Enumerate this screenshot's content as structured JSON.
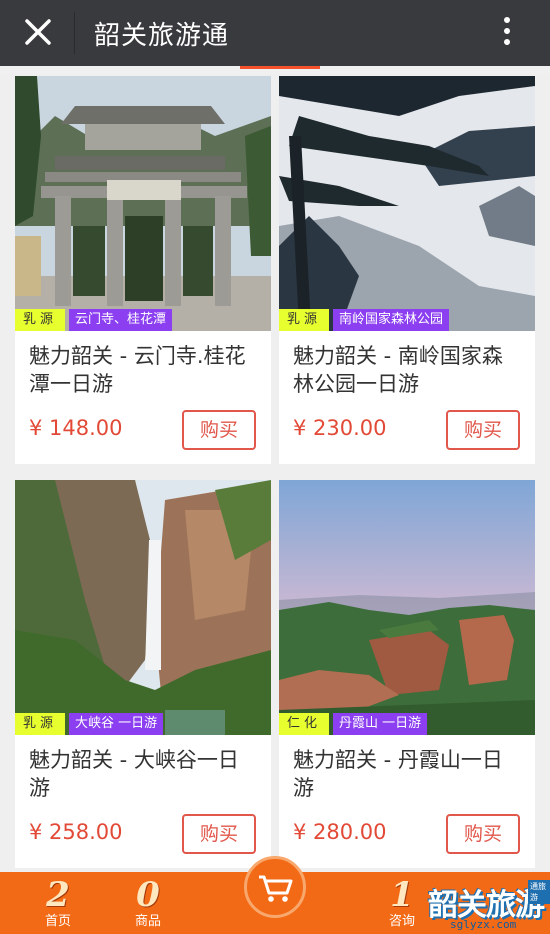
{
  "header": {
    "title": "韶关旅游通",
    "close_icon": "close-icon",
    "more_icon": "more-vertical-icon"
  },
  "products": [
    {
      "region": "乳源",
      "tag": "云门寺、桂花潭",
      "name": "魅力韶关 - 云门寺.桂花潭一日游",
      "price": "¥ 148.00",
      "buy_label": "购买"
    },
    {
      "region": "乳源",
      "tag": "南岭国家森林公园",
      "name": "魅力韶关 - 南岭国家森林公园一日游",
      "price": "¥ 230.00",
      "buy_label": "购买"
    },
    {
      "region": "乳源",
      "tag": "大峡谷 一日游",
      "name": "魅力韶关 - 大峡谷一日游",
      "price": "¥ 258.00",
      "buy_label": "购买"
    },
    {
      "region": "仁化",
      "tag": "丹霞山 一日游",
      "name": "魅力韶关 - 丹霞山一日游",
      "price": "¥ 280.00",
      "buy_label": "购买"
    }
  ],
  "footer": {
    "nav": [
      {
        "label": "首页",
        "glyph": "2"
      },
      {
        "label": "商品",
        "glyph": "0"
      },
      {
        "label": "咨询",
        "glyph": "1"
      }
    ],
    "cart_icon": "cart-icon",
    "logo_text": "韶关旅游",
    "logo_small": "通旅游",
    "logo_url": "sglyzx.com"
  },
  "colors": {
    "header_bg": "#393a3e",
    "accent": "#f36a16",
    "price": "#e24a37",
    "tag_region_bg": "#e8ff2f",
    "tag_label_bg": "#8b3ff0"
  }
}
